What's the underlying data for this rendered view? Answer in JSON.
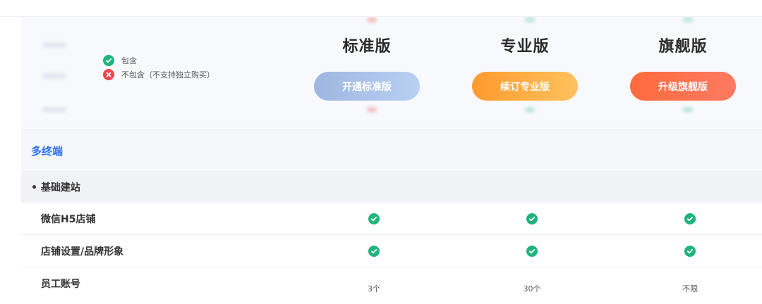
{
  "legend": {
    "included_label": "包含",
    "excluded_label": "不包含（不支持独立购买）"
  },
  "plans": [
    {
      "title": "标准版",
      "button_label": "开通标准版"
    },
    {
      "title": "专业版",
      "button_label": "续订专业版"
    },
    {
      "title": "旗舰版",
      "button_label": "升级旗舰版"
    }
  ],
  "section": {
    "title": "多终端"
  },
  "group": {
    "title": "• 基础建站"
  },
  "rows": [
    {
      "label": "微信H5店铺",
      "values": [
        "check",
        "check",
        "check"
      ]
    },
    {
      "label": "店铺设置/品牌形象",
      "values": [
        "check",
        "check",
        "check"
      ]
    },
    {
      "label": "员工账号",
      "values": [
        "3个",
        "30个",
        "不限"
      ]
    }
  ],
  "colors": {
    "check": "#1fb47c",
    "cross": "#f04650",
    "section_title": "#2f72f0",
    "standard_button": "#a8c0ea",
    "pro_button": "#ffa83d",
    "flagship_button": "#ff6f49"
  }
}
